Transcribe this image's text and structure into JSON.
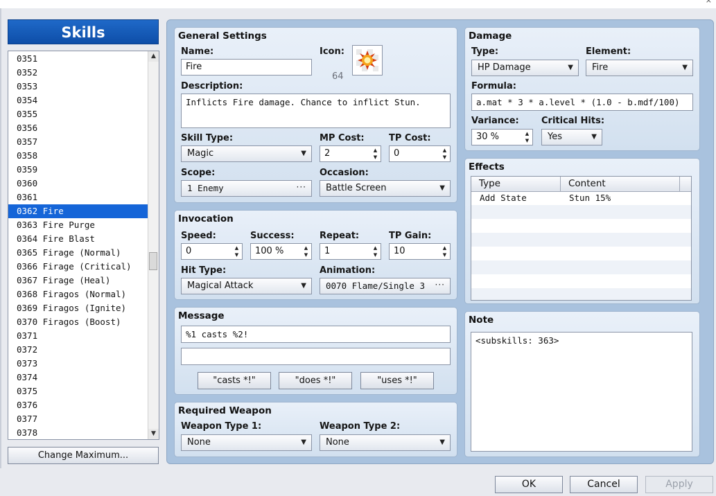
{
  "window": {
    "close_glyph": "×"
  },
  "sidebar": {
    "title": "Skills",
    "items": [
      "0351",
      "0352",
      "0353",
      "0354",
      "0355",
      "0356",
      "0357",
      "0358",
      "0359",
      "0360",
      "0361",
      "0362 Fire",
      "0363 Fire Purge",
      "0364 Fire Blast",
      "0365 Firage (Normal)",
      "0366 Firage (Critical)",
      "0367 Firage (Heal)",
      "0368 Firagos (Normal)",
      "0369 Firagos (Ignite)",
      "0370 Firagos (Boost)",
      "0371",
      "0372",
      "0373",
      "0374",
      "0375",
      "0376",
      "0377",
      "0378"
    ],
    "selected_index": 11,
    "change_max_label": "Change Maximum..."
  },
  "general": {
    "title": "General Settings",
    "name_label": "Name:",
    "name_value": "Fire",
    "icon_label": "Icon:",
    "icon_index": "64",
    "icon_name": "fire-burst-icon",
    "description_label": "Description:",
    "description_value": "Inflicts Fire damage. Chance to inflict Stun.",
    "skill_type_label": "Skill Type:",
    "skill_type_value": "Magic",
    "mp_cost_label": "MP Cost:",
    "mp_cost_value": "2",
    "tp_cost_label": "TP Cost:",
    "tp_cost_value": "0",
    "scope_label": "Scope:",
    "scope_value": "1 Enemy",
    "occasion_label": "Occasion:",
    "occasion_value": "Battle Screen"
  },
  "invocation": {
    "title": "Invocation",
    "speed_label": "Speed:",
    "speed_value": "0",
    "success_label": "Success:",
    "success_value": "100 %",
    "repeat_label": "Repeat:",
    "repeat_value": "1",
    "tp_gain_label": "TP Gain:",
    "tp_gain_value": "10",
    "hit_type_label": "Hit Type:",
    "hit_type_value": "Magical Attack",
    "animation_label": "Animation:",
    "animation_value": "0070 Flame/Single 3"
  },
  "message": {
    "title": "Message",
    "line1": "%1 casts %2!",
    "line2": "",
    "btn_casts": "\"casts *!\"",
    "btn_does": "\"does *!\"",
    "btn_uses": "\"uses *!\""
  },
  "weapon": {
    "title": "Required Weapon",
    "type1_label": "Weapon Type 1:",
    "type1_value": "None",
    "type2_label": "Weapon Type 2:",
    "type2_value": "None"
  },
  "damage": {
    "title": "Damage",
    "type_label": "Type:",
    "type_value": "HP Damage",
    "element_label": "Element:",
    "element_value": "Fire",
    "formula_label": "Formula:",
    "formula_value": "a.mat * 3 * a.level * (1.0 - b.mdf/100)",
    "variance_label": "Variance:",
    "variance_value": "30 %",
    "critical_label": "Critical Hits:",
    "critical_value": "Yes"
  },
  "effects": {
    "title": "Effects",
    "col_type": "Type",
    "col_content": "Content",
    "rows": [
      {
        "type": "Add State",
        "content": "Stun 15%"
      }
    ]
  },
  "note": {
    "title": "Note",
    "value": "<subskills: 363>"
  },
  "dialog": {
    "ok": "OK",
    "cancel": "Cancel",
    "apply": "Apply"
  },
  "colors": {
    "selection": "#1565d8",
    "header": "#0e4ea8",
    "panel_bg": "#a9c2de"
  }
}
